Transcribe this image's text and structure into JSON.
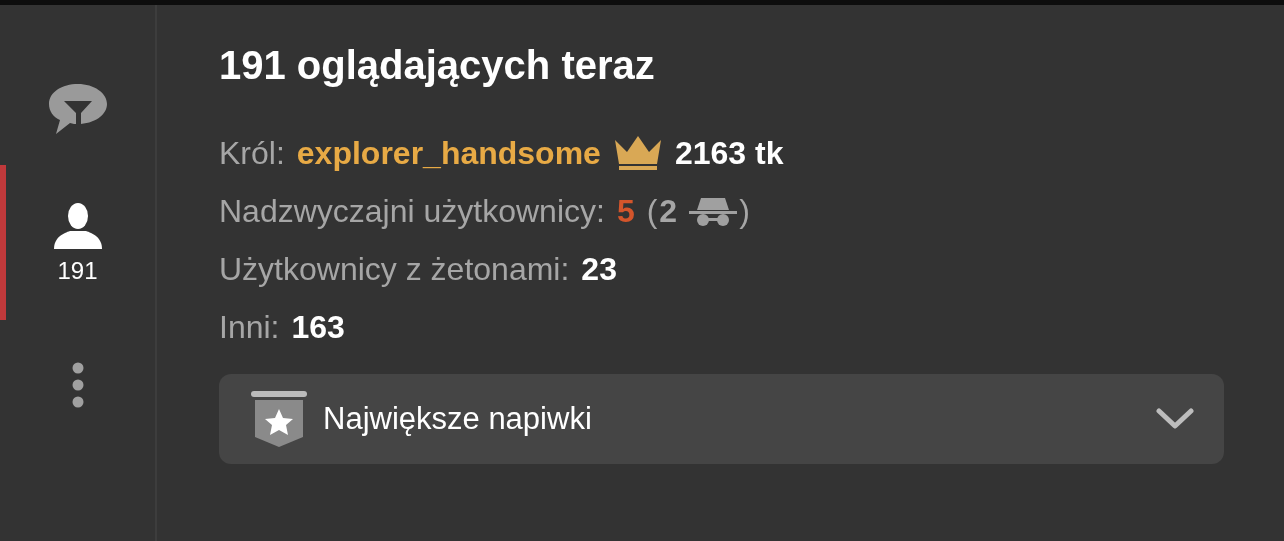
{
  "sidebar": {
    "items": [
      {
        "kind": "chat-filter",
        "selected": false
      },
      {
        "kind": "users",
        "label": "191",
        "selected": true
      },
      {
        "kind": "more",
        "selected": false
      }
    ]
  },
  "title": "191 oglądających teraz",
  "stats": [
    {
      "kind": "king",
      "label": "Król:",
      "user": "explorer_handsome",
      "value": "2163 tk"
    },
    {
      "kind": "special",
      "label": "Nadzwyczajni użytkownicy:",
      "value": "5",
      "open": "(",
      "hidden_count": "2",
      "close": ")"
    },
    {
      "kind": "plain",
      "label": "Użytkownicy z żetonami:",
      "value": "23"
    },
    {
      "kind": "plain",
      "label": "Inni:",
      "value": "163"
    }
  ],
  "dropdown": {
    "label": "Największe napiwki",
    "expanded": false
  }
}
